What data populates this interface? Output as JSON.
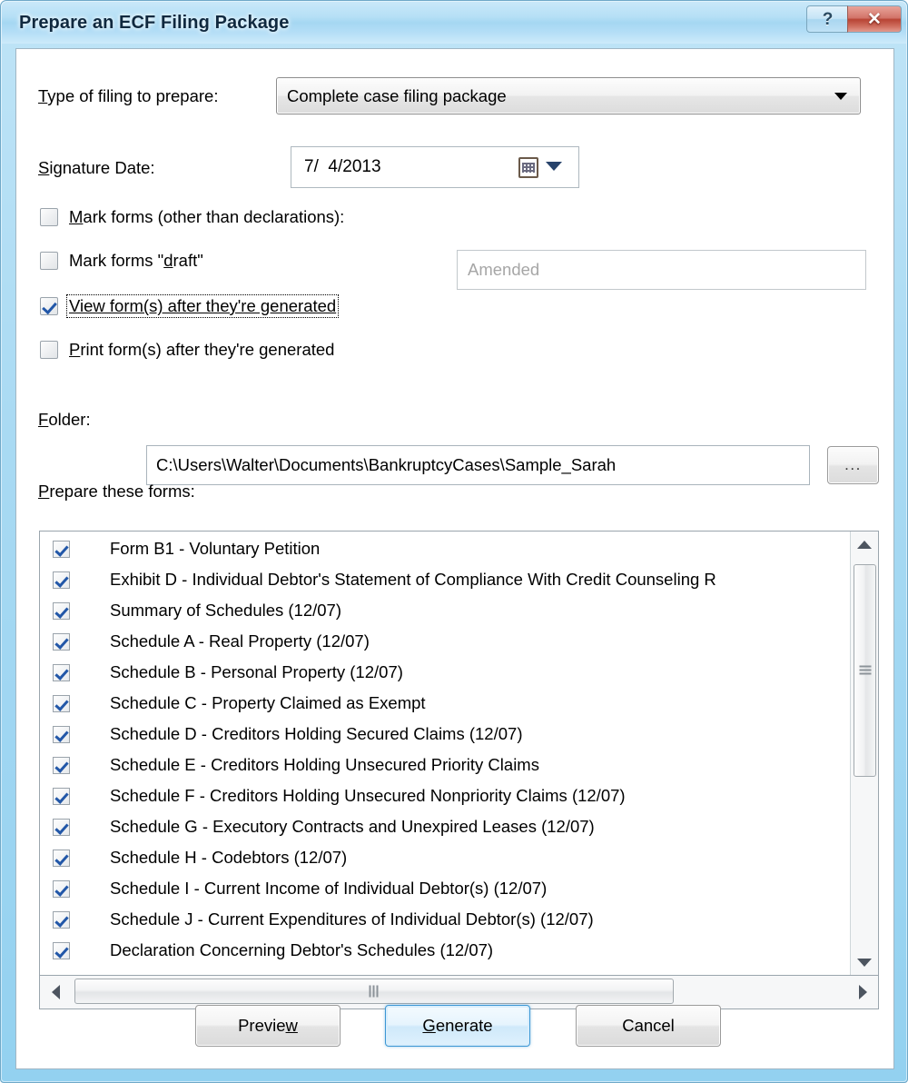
{
  "window": {
    "title": "Prepare an ECF Filing Package",
    "help_glyph": "?",
    "close_glyph": "✕",
    "accent_color": "#3c97d4",
    "titlebar_color": "#a5d7f2",
    "close_color": "#b84434"
  },
  "filing_type": {
    "label_pre": "T",
    "label_post": "ype of filing to prepare:",
    "value": "Complete case filing package",
    "options": [
      "Complete case filing package"
    ]
  },
  "signature_date": {
    "label_pre": "S",
    "label_post": "ignature Date:",
    "value": "7/  4/2013"
  },
  "options": [
    {
      "label_pre": "M",
      "label_post": "ark forms (other than declarations):",
      "checked": false,
      "focused": false
    },
    {
      "label_pre": "",
      "label_post": "Mark forms \"draft\"",
      "acc_mid_before": "Mark forms \"",
      "acc_mid_char": "d",
      "acc_mid_after": "raft\"",
      "checked": false,
      "focused": false
    },
    {
      "label_pre": "V",
      "label_post": "iew form(s) after they're generated",
      "checked": true,
      "focused": true
    },
    {
      "label_pre": "P",
      "label_post": "rint form(s) after they're generated",
      "checked": false,
      "focused": false
    }
  ],
  "amended_field": {
    "value": "",
    "placeholder": "Amended",
    "enabled": false
  },
  "folder": {
    "label_pre": "F",
    "label_post": "older:",
    "value": "C:\\Users\\Walter\\Documents\\BankruptcyCases\\Sample_Sarah",
    "browse_label": "..."
  },
  "forms_list": {
    "label_pre": "P",
    "label_post": "repare these forms:",
    "items": [
      {
        "label": "Form B1 - Voluntary Petition",
        "checked": true
      },
      {
        "label": "Exhibit D - Individual Debtor's Statement of Compliance With Credit Counseling R",
        "checked": true
      },
      {
        "label": "Summary of Schedules (12/07)",
        "checked": true
      },
      {
        "label": "Schedule A - Real Property (12/07)",
        "checked": true
      },
      {
        "label": "Schedule B - Personal Property (12/07)",
        "checked": true
      },
      {
        "label": "Schedule C - Property Claimed as Exempt",
        "checked": true
      },
      {
        "label": "Schedule D - Creditors Holding Secured Claims (12/07)",
        "checked": true
      },
      {
        "label": "Schedule E - Creditors Holding Unsecured Priority Claims",
        "checked": true
      },
      {
        "label": "Schedule F - Creditors Holding Unsecured Nonpriority Claims (12/07)",
        "checked": true
      },
      {
        "label": "Schedule G - Executory Contracts and Unexpired Leases (12/07)",
        "checked": true
      },
      {
        "label": "Schedule H - Codebtors (12/07)",
        "checked": true
      },
      {
        "label": "Schedule I - Current Income of Individual Debtor(s) (12/07)",
        "checked": true
      },
      {
        "label": "Schedule J - Current Expenditures of Individual Debtor(s) (12/07)",
        "checked": true
      },
      {
        "label": "Declaration Concerning Debtor's Schedules (12/07)",
        "checked": true
      }
    ]
  },
  "buttons": {
    "preview_pre": "Previe",
    "preview_acc": "w",
    "generate_acc": "G",
    "generate_post": "enerate",
    "cancel": "Cancel"
  }
}
